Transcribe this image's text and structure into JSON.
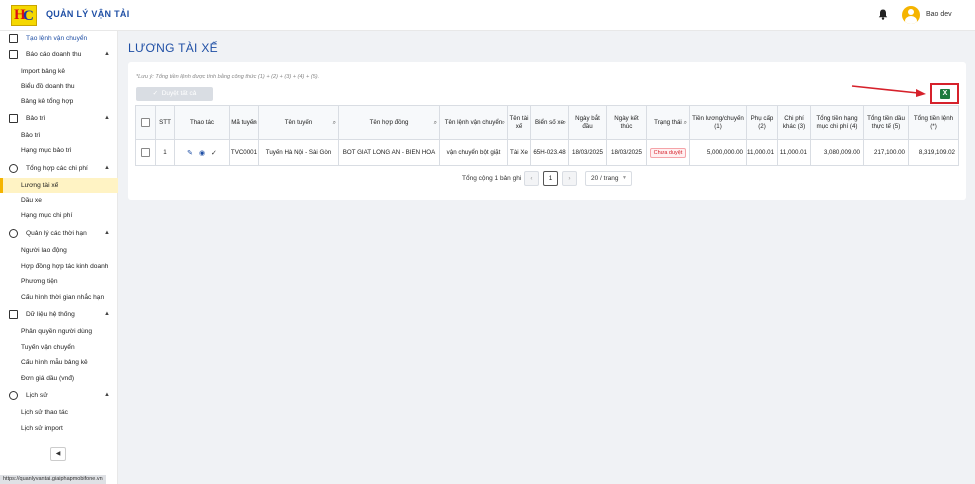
{
  "app": {
    "title": "QUẢN LÝ VẬN TẢI",
    "logo_text": "HC"
  },
  "header": {
    "user_name": "Bao dev"
  },
  "sidebar": {
    "top_item": "Tạo lệnh vận chuyển",
    "groups": [
      {
        "label": "Báo cáo doanh thu",
        "items": [
          "Import bảng kê",
          "Biểu đồ doanh thu",
          "Bảng kê tổng hợp"
        ]
      },
      {
        "label": "Bảo trì",
        "items": [
          "Bảo trì",
          "Hạng mục bảo trì"
        ]
      },
      {
        "label": "Tổng hợp các chi phí",
        "items": [
          "Lương tài xế",
          "Dầu xe",
          "Hạng mục chi phí"
        ]
      },
      {
        "label": "Quản lý các thời hạn",
        "items": [
          "Người lao động",
          "Hợp đồng hợp tác kinh doanh",
          "Phương tiện",
          "Cấu hình thời gian nhắc hạn"
        ]
      },
      {
        "label": "Dữ liệu hệ thống",
        "items": [
          "Phân quyền người dùng",
          "Tuyến vận chuyển",
          "Cấu hình mẫu bảng kê",
          "Đơn giá dầu (vnđ)"
        ]
      },
      {
        "label": "Lịch sử",
        "items": [
          "Lịch sử thao tác",
          "Lịch sử import"
        ]
      }
    ],
    "active_item": "Lương tài xế"
  },
  "status_url": "https://quanlyvantai.giaiphapmobifone.vn",
  "page": {
    "title": "LƯƠNG TÀI XẾ",
    "note": "*Lưu ý: Tổng tiền lệnh được tính bằng công thức (1) + (2) + (3) + (4) + (5).",
    "approve_all_label": "Duyệt tất cả",
    "excel_label": "X"
  },
  "table": {
    "headers": [
      "STT",
      "Thao tác",
      "Mã tuyến",
      "Tên tuyến",
      "Tên hợp đồng",
      "Tên lệnh vận chuyển",
      "Tên tài xế",
      "Biển số xe",
      "Ngày bắt đầu",
      "Ngày kết thúc",
      "Trạng thái",
      "Tiền lương/chuyến (1)",
      "Phụ cấp (2)",
      "Chi phí khác (3)",
      "Tổng tiền hạng mục chi phí (4)",
      "Tổng tiền dầu thực tế (5)",
      "Tổng tiền lệnh (*)"
    ],
    "rows": [
      {
        "stt": "1",
        "ma_tuyen": "TVC0001",
        "ten_tuyen": "Tuyến Hà Nội - Sài Gòn",
        "ten_hop_dong": "BOT GIAT LONG AN - BIEN HOA",
        "ten_lenh": "vận chuyển bột giặt",
        "ten_tai_xe": "Tài Xe",
        "bien_so": "65H-023.48",
        "ngay_bat_dau": "18/03/2025",
        "ngay_ket_thuc": "18/03/2025",
        "trang_thai": "Chưa duyệt",
        "tien_luong": "5,000,000.00",
        "phu_cap": "11,000.01",
        "chi_phi_khac": "11,000.01",
        "tong_hang_muc": "3,080,009.00",
        "tong_dau": "217,100.00",
        "tong_lenh": "8,319,109.02"
      }
    ]
  },
  "pagination": {
    "total": "Tổng cộng 1 bản ghi",
    "current": "1",
    "page_size": "20 / trang"
  }
}
